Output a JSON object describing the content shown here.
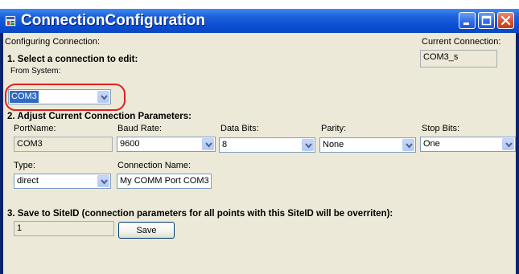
{
  "window": {
    "title": "ConnectionConfiguration"
  },
  "header": {
    "configuring_label": "Configuring Connection:",
    "current_connection_label": "Current Connection:",
    "current_connection_value": "COM3_s"
  },
  "section1": {
    "heading": "1. Select a connection to edit:",
    "from_system_label": "From System:",
    "from_system_value": "COM3"
  },
  "section2": {
    "heading": "2. Adjust Current Connection Parameters:",
    "port_name": {
      "label": "PortName:",
      "value": "COM3"
    },
    "baud_rate": {
      "label": "Baud Rate:",
      "value": "9600"
    },
    "data_bits": {
      "label": "Data Bits:",
      "value": "8"
    },
    "parity": {
      "label": "Parity:",
      "value": "None"
    },
    "stop_bits": {
      "label": "Stop Bits:",
      "value": "One"
    },
    "type": {
      "label": "Type:",
      "value": "direct"
    },
    "connection_name": {
      "label": "Connection Name:",
      "value": "My COMM Port COM3"
    }
  },
  "section3": {
    "heading": "3. Save to SiteID (connection parameters for all points with this SiteID will be overriten):",
    "site_id_value": "1",
    "save_label": "Save"
  },
  "colors": {
    "titlebar": "#0a4ed4",
    "client_bg": "#ece9d8",
    "highlight": "#e02020",
    "selection": "#316ac5"
  },
  "icons": [
    "app-icon",
    "minimize-icon",
    "maximize-icon",
    "close-icon",
    "chevron-down-icon"
  ]
}
